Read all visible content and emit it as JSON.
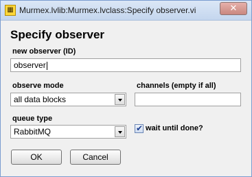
{
  "window": {
    "title": "Murmex.lvlib:Murmex.lvclass:Specify observer.vi",
    "close_glyph": "✕",
    "icon_glyph": "▦"
  },
  "dialog": {
    "heading": "Specify observer",
    "new_observer": {
      "label": "new observer (ID)",
      "value": "observer"
    },
    "observe_mode": {
      "label": "observe mode",
      "selected": "all data blocks"
    },
    "channels": {
      "label": "channels (empty if all)",
      "value": ""
    },
    "queue_type": {
      "label": "queue type",
      "selected": "RabbitMQ"
    },
    "wait_until_done": {
      "label": "wait until done?",
      "checked": true,
      "check_glyph": "✔"
    },
    "buttons": {
      "ok": "OK",
      "cancel": "Cancel"
    }
  }
}
